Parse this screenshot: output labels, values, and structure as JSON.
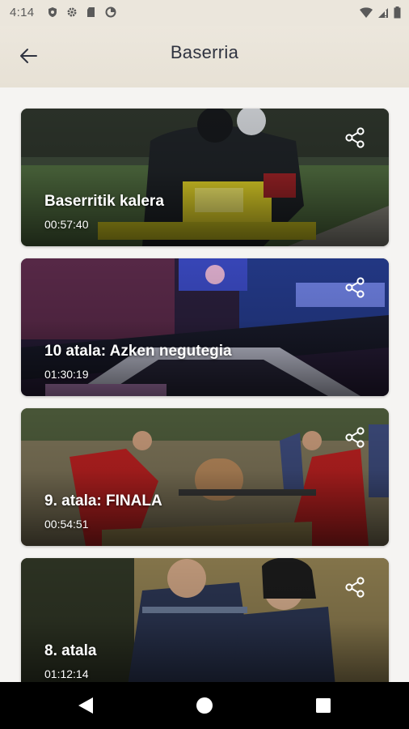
{
  "status_bar": {
    "time": "4:14",
    "icons": [
      "shield-icon",
      "gear-icon",
      "sd-card-icon",
      "data-saver-icon"
    ],
    "right_icons": [
      "wifi-icon",
      "signal-icon",
      "battery-icon"
    ]
  },
  "header": {
    "title": "Baserria",
    "back_icon": "arrow-left-icon"
  },
  "episodes": [
    {
      "title": "Baserritik kalera",
      "duration": "00:57:40"
    },
    {
      "title": "10 atala: Azken negutegia",
      "duration": "01:30:19"
    },
    {
      "title": "9. atala: FINALA",
      "duration": "00:54:51"
    },
    {
      "title": "8. atala",
      "duration": "01:12:14"
    }
  ],
  "nav_bar": {
    "buttons": [
      "back-triangle-icon",
      "home-circle-icon",
      "recents-square-icon"
    ]
  },
  "colors": {
    "header_bg": "#ece7dd",
    "title_color": "#2f3340",
    "content_bg": "#f5f4f2",
    "nav_bg": "#000000"
  }
}
